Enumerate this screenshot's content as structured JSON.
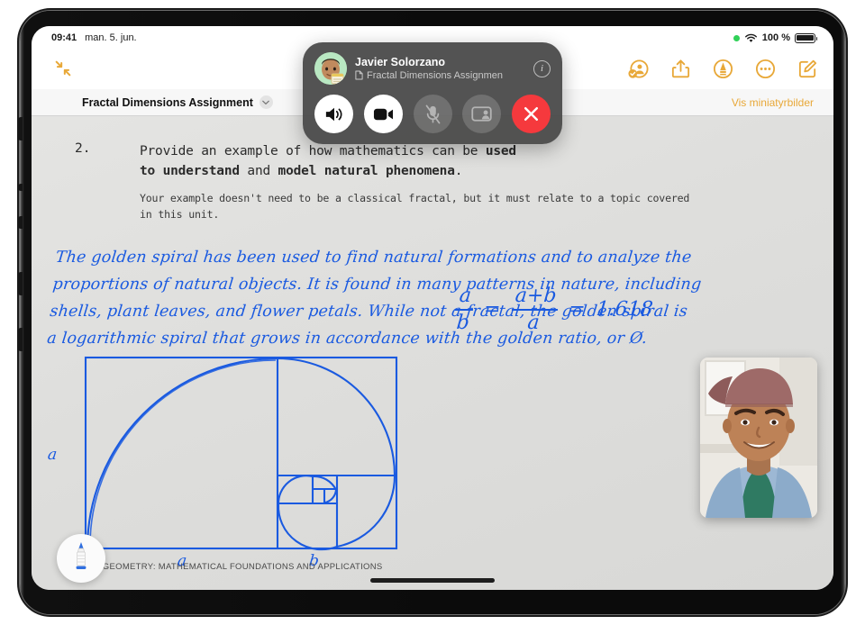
{
  "status_bar": {
    "time": "09:41",
    "date": "man. 5. jun.",
    "battery_percent": "100 %",
    "recording_indicator": "green-dot",
    "wifi_icon": "wifi-icon",
    "battery_icon": "battery-icon"
  },
  "toolbar": {
    "collapse_icon": "exit-fullscreen-icon",
    "icons": [
      {
        "name": "collaborate-icon",
        "label": "Collaborate"
      },
      {
        "name": "share-icon",
        "label": "Share"
      },
      {
        "name": "markup-pen-icon",
        "label": "Markup"
      },
      {
        "name": "more-options-icon",
        "label": "More"
      },
      {
        "name": "compose-icon",
        "label": "Compose"
      }
    ],
    "accent_color": "#e8a838"
  },
  "subtoolbar": {
    "document_title": "Fractal Dimensions Assignment",
    "chevron_icon": "chevron-down-icon",
    "thumbnails_label": "Vis miniatyrbilder"
  },
  "facetime": {
    "caller_name": "Javier Solorzano",
    "shared_doc": "Fractal Dimensions Assignmen",
    "doc_icon": "document-icon",
    "avatar_icon": "memoji-avatar",
    "info_label": "i",
    "buttons": [
      {
        "name": "speaker-button",
        "icon": "speaker-icon",
        "state": "active"
      },
      {
        "name": "video-button",
        "icon": "video-camera-icon",
        "state": "active"
      },
      {
        "name": "mute-button",
        "icon": "microphone-muted-icon",
        "state": "muted"
      },
      {
        "name": "shareplay-button",
        "icon": "share-screen-icon",
        "state": "inactive"
      },
      {
        "name": "end-call-button",
        "icon": "close-x-icon",
        "state": "danger"
      }
    ],
    "end_call_color": "#f5393d"
  },
  "document": {
    "question_number": "2.",
    "question_parts": [
      {
        "text": "Provide an example of how mathematics can be ",
        "bold": false
      },
      {
        "text": "used",
        "bold": true
      },
      {
        "text": "to understand",
        "bold": true
      },
      {
        "text": " and ",
        "bold": false
      },
      {
        "text": "model natural phenomena",
        "bold": true
      },
      {
        "text": ".",
        "bold": false
      }
    ],
    "question_line1_plain": "Provide an example of how mathematics can be ",
    "question_line1_bold": "used",
    "question_line2_bold_a": "to understand",
    "question_line2_plain": " and ",
    "question_line2_bold_b": "model natural phenomena",
    "question_line2_end": ".",
    "question_sub": "Your example doesn't need to be a classical fractal, but it must relate to a topic covered in this unit.",
    "handwritten_answer": [
      "The golden spiral has been used to find natural formations and to analyze the",
      "proportions of natural objects. It is found in many patterns in nature, including",
      "shells, plant leaves, and flower petals. While not a fractal, the golden spiral is",
      "a logarithmic spiral that grows in accordance with the golden ratio, or Ø."
    ],
    "ink_color": "#1a5ae0",
    "diagram": {
      "name": "golden-spiral-diagram",
      "label_left": "a",
      "label_bottom_left": "a",
      "label_bottom_right": "b"
    },
    "formula": {
      "left_num": "a",
      "left_den": "b",
      "eq1": "=",
      "mid_num": "a+b",
      "mid_den": "a",
      "eq2": "=",
      "result": "1.618"
    },
    "footer": "AL GEOMETRY: MATHEMATICAL FOUNDATIONS AND APPLICATIONS"
  },
  "pen_widget": {
    "icon": "apple-pencil-icon",
    "tip_color": "#1a5ae0"
  },
  "pip": {
    "name": "video-pip",
    "cap_color": "#9e6a68",
    "jacket_color": "#9db8d4",
    "shirt_color": "#2f7a62"
  },
  "home_indicator": "home-indicator"
}
